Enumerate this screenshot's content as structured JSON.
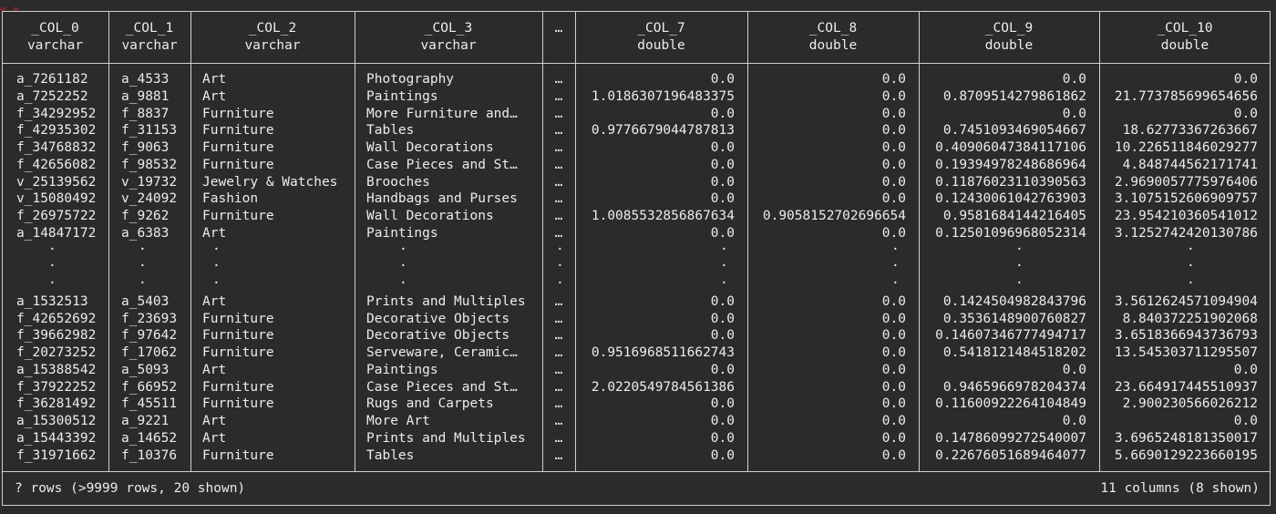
{
  "columns": [
    {
      "name": "_COL_0",
      "type": "varchar"
    },
    {
      "name": "_COL_1",
      "type": "varchar"
    },
    {
      "name": "_COL_2",
      "type": "varchar"
    },
    {
      "name": "_COL_3",
      "type": "varchar"
    },
    {
      "name": "…",
      "type": ""
    },
    {
      "name": "_COL_7",
      "type": "double"
    },
    {
      "name": "_COL_8",
      "type": "double"
    },
    {
      "name": "_COL_9",
      "type": "double"
    },
    {
      "name": "_COL_10",
      "type": "double"
    }
  ],
  "ellipsis": "…",
  "vdot": "·",
  "rows_top": [
    [
      "a_7261182",
      "a_4533",
      "Art",
      "Photography",
      "0.0",
      "0.0",
      "0.0",
      "0.0"
    ],
    [
      "a_7252252",
      "a_9881",
      "Art",
      "Paintings",
      "1.0186307196483375",
      "0.0",
      "0.8709514279861862",
      "21.77378569965465 6"
    ],
    [
      "f_34292952",
      "f_8837",
      "Furniture",
      "More Furniture and…",
      "0.0",
      "0.0",
      "0.0",
      "0.0"
    ],
    [
      "f_42935302",
      "f_31153",
      "Furniture",
      "Tables",
      "0.9776679044787813",
      "0.0",
      "0.7451093469054667",
      "18.6277336726366 7"
    ],
    [
      "f_34768832",
      "f_9063",
      "Furniture",
      "Wall Decorations",
      "0.0",
      "0.0",
      "0.40906047384117106",
      "10.226511846029277"
    ],
    [
      "f_42656082",
      "f_98532",
      "Furniture",
      "Case Pieces and St…",
      "0.0",
      "0.0",
      "0.19394978248686964",
      "4.848744562171741"
    ],
    [
      "v_25139562",
      "v_19732",
      "Jewelry & Watches",
      "Brooches",
      "0.0",
      "0.0",
      "0.11876023110390563",
      "2.969005777597640 6"
    ],
    [
      "v_15080492",
      "v_24092",
      "Fashion",
      "Handbags and Purses",
      "0.0",
      "0.0",
      "0.12430061042763903",
      "3.1075152606909757"
    ],
    [
      "f_26975722",
      "f_9262",
      "Furniture",
      "Wall Decorations",
      "1.0085532856867634",
      "0.9058152702696654",
      "0.9581684144216405",
      "23.954210360541012"
    ],
    [
      "a_14847172",
      "a_6383",
      "Art",
      "Paintings",
      "0.0",
      "0.0",
      "0.12501096968052314",
      "3.1252742420130786"
    ]
  ],
  "rows_bottom": [
    [
      "a_1532513",
      "a_5403",
      "Art",
      "Prints and Multiples",
      "0.0",
      "0.0",
      "0.1424504982843796",
      "3.5612624571094904"
    ],
    [
      "f_42652692",
      "f_23693",
      "Furniture",
      "Decorative Objects",
      "0.0",
      "0.0",
      "0.3536148900760827",
      "8.840372251902068"
    ],
    [
      "f_39662982",
      "f_97642",
      "Furniture",
      "Decorative Objects",
      "0.0",
      "0.0",
      "0.14607346777494717",
      "3.6518366943736793"
    ],
    [
      "f_20273252",
      "f_17062",
      "Furniture",
      "Serveware, Ceramic…",
      "0.9516968511662743",
      "0.0",
      "0.5418121484518202",
      "13.545303711295507"
    ],
    [
      "a_15388542",
      "a_5093",
      "Art",
      "Paintings",
      "0.0",
      "0.0",
      "0.0",
      "0.0"
    ],
    [
      "f_37922252",
      "f_66952",
      "Furniture",
      "Case Pieces and St…",
      "2.0220549784561386",
      "0.0",
      "0.9465966978204374",
      "23.664917445510937"
    ],
    [
      "f_36281492",
      "f_45511",
      "Furniture",
      "Rugs and Carpets",
      "0.0",
      "0.0",
      "0.11600922264104849",
      "2.900230566026212"
    ],
    [
      "a_15300512",
      "a_9221",
      "Art",
      "More Art",
      "0.0",
      "0.0",
      "0.0",
      "0.0"
    ],
    [
      "a_15443392",
      "a_14652",
      "Art",
      "Prints and Multiples",
      "0.0",
      "0.0",
      "0.14786099272540007",
      "3.6965248181350017"
    ],
    [
      "f_31971662",
      "f_10376",
      "Furniture",
      "Tables",
      "0.0",
      "0.0",
      "0.22676051689464077",
      "5.6690129223660195"
    ]
  ],
  "footer": {
    "left": "? rows (>9999 rows, 20 shown)",
    "right": "11 columns (8 shown)"
  }
}
